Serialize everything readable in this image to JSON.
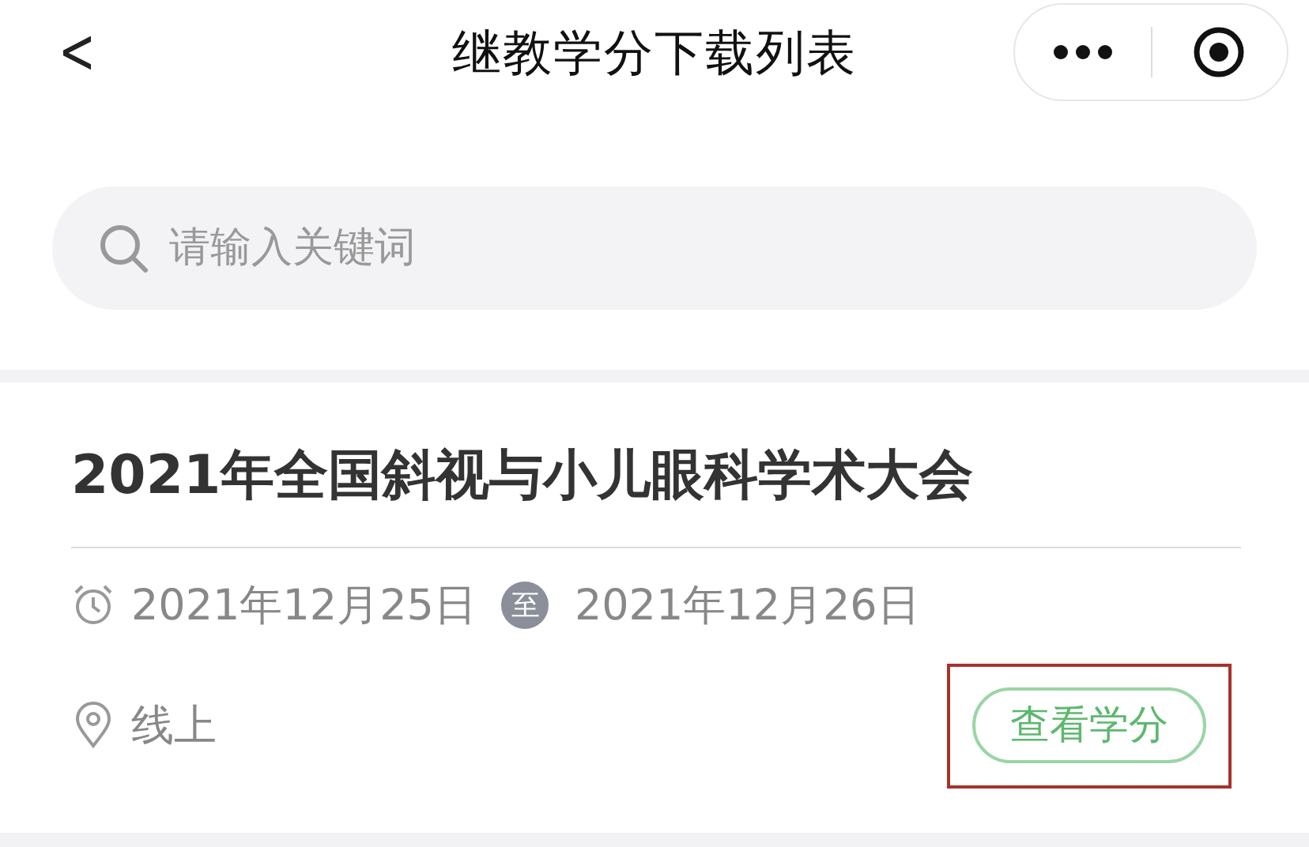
{
  "nav_bar": {
    "back": "<",
    "title": "继教学分下载列表"
  },
  "search": {
    "placeholder": "请输入关键词"
  },
  "events": [
    {
      "title": "2021年全国斜视与小儿眼科学术大会",
      "start_date": "2021年12月25日",
      "range_separator": "至",
      "end_date": "2021年12月26日",
      "location": "线上",
      "action": {
        "label": "查看学分",
        "highlighted": true
      }
    }
  ]
}
